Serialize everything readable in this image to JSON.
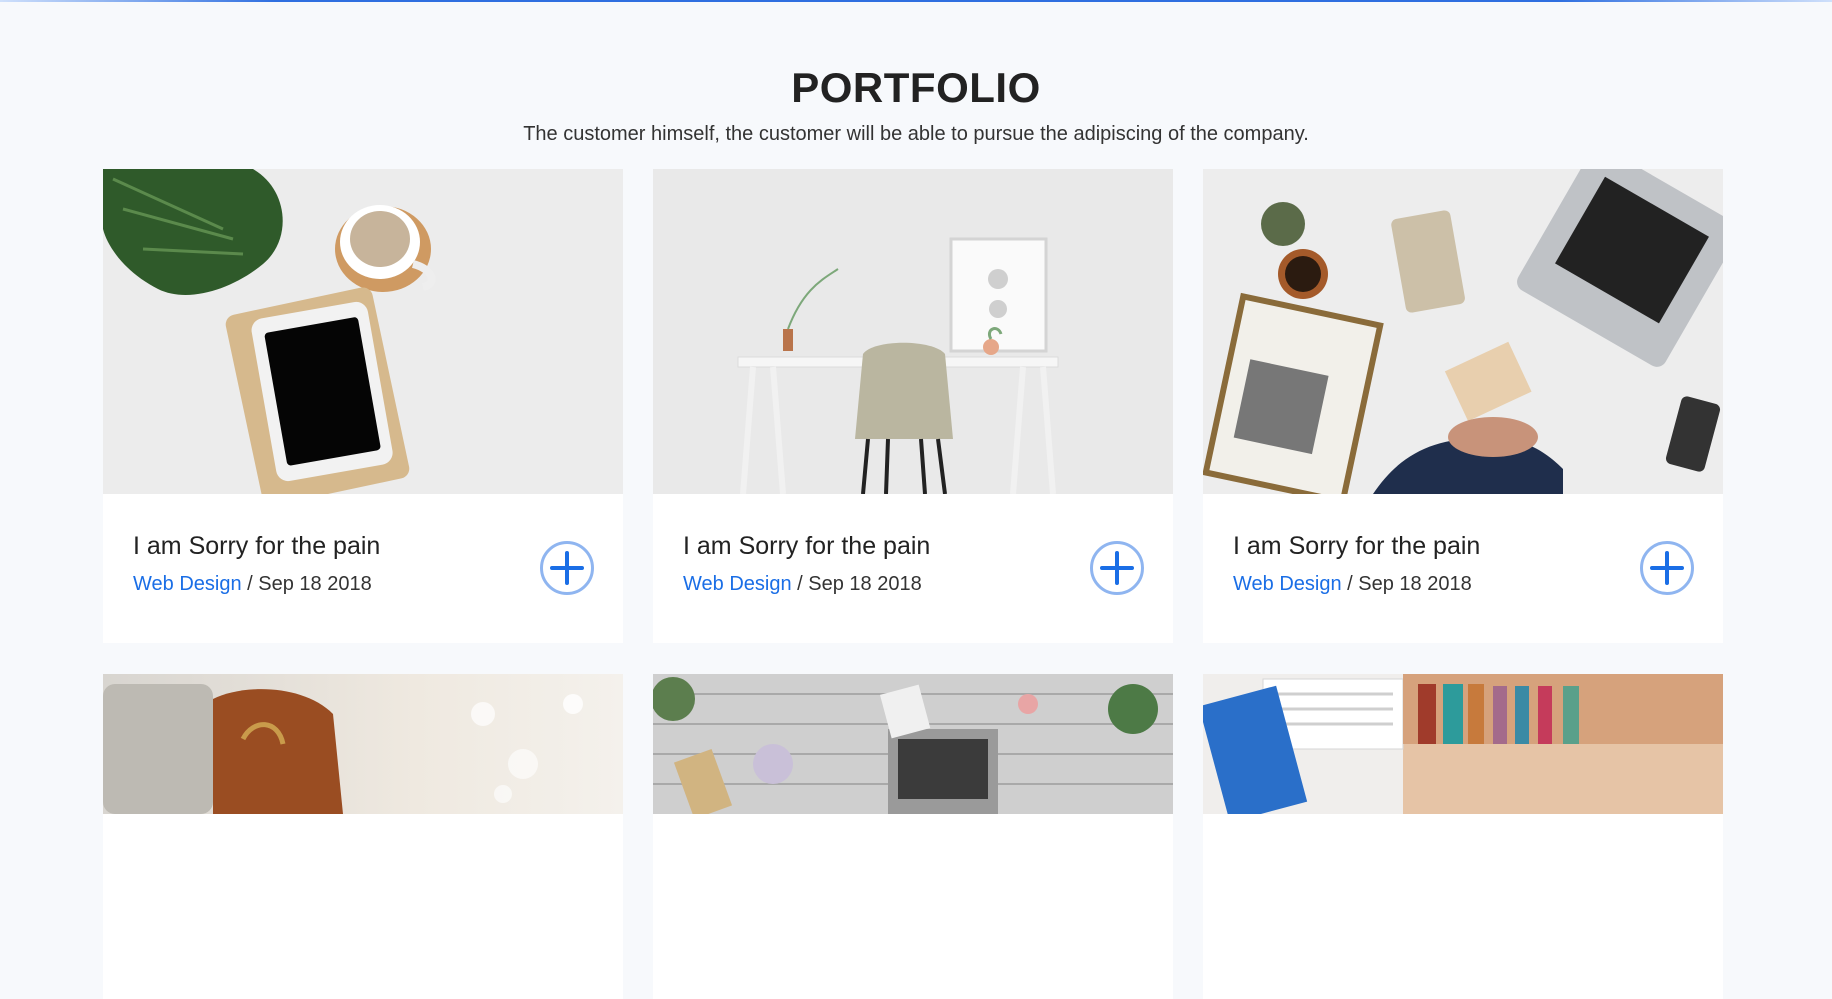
{
  "section": {
    "title": "PORTFOLIO",
    "subtitle": "The customer himself, the customer will be able to pursue the adipiscing of the company."
  },
  "items": [
    {
      "title": "I am Sorry for the pain",
      "category": "Web Design",
      "separator": "/",
      "date": "Sep 18 2018",
      "image": "tablet-plant-coffee-photo"
    },
    {
      "title": "I am Sorry for the pain",
      "category": "Web Design",
      "separator": "/",
      "date": "Sep 18 2018",
      "image": "desk-chair-photo"
    },
    {
      "title": "I am Sorry for the pain",
      "category": "Web Design",
      "separator": "/",
      "date": "Sep 18 2018",
      "image": "business-desk-laptop-photo"
    },
    {
      "title": "",
      "category": "",
      "separator": "",
      "date": "",
      "image": "leather-bag-laptop-photo"
    },
    {
      "title": "",
      "category": "",
      "separator": "",
      "date": "",
      "image": "flowers-laptop-table-photo"
    },
    {
      "title": "",
      "category": "",
      "separator": "",
      "date": "",
      "image": "keyboard-books-photo"
    }
  ],
  "colors": {
    "accent": "#1a6ee6",
    "plus_ring": "#8fb5f0",
    "background": "#f7f9fc"
  },
  "icons": {
    "plus": "plus-circle-icon"
  }
}
